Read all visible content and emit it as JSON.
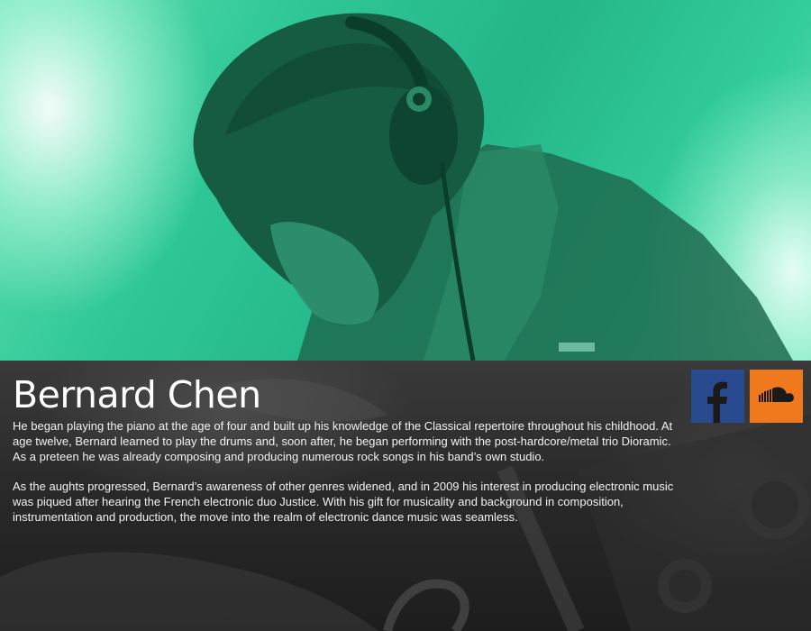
{
  "artist": {
    "name": "Bernard Chen"
  },
  "bio": {
    "paragraphs": [
      "He began playing the piano at the age of four and built up his knowledge of the Classical repertoire throughout his childhood. At age twelve, Bernard learned to play the drums and, soon after, he began performing with the post-hardcore/metal trio Dioramic. As a preteen he was already composing and producing numerous rock songs in his band’s own studio.",
      "As the aughts progressed, Bernard’s awareness of other genres widened, and in 2009 his interest in producing electronic music was piqued after hearing the French electronic duo Justice. With his gift for musicality and background in composition, instrumentation and production, the move into the realm of electronic dance music was seamless."
    ]
  },
  "social": {
    "links": [
      {
        "icon": "facebook-icon",
        "color": "#294a8f"
      },
      {
        "icon": "soundcloud-icon",
        "color": "#f0791e"
      }
    ]
  },
  "theme": {
    "hero_tint": "#2fc796",
    "panel_bg": "#2a2a2a",
    "text_color": "#ffffff"
  }
}
